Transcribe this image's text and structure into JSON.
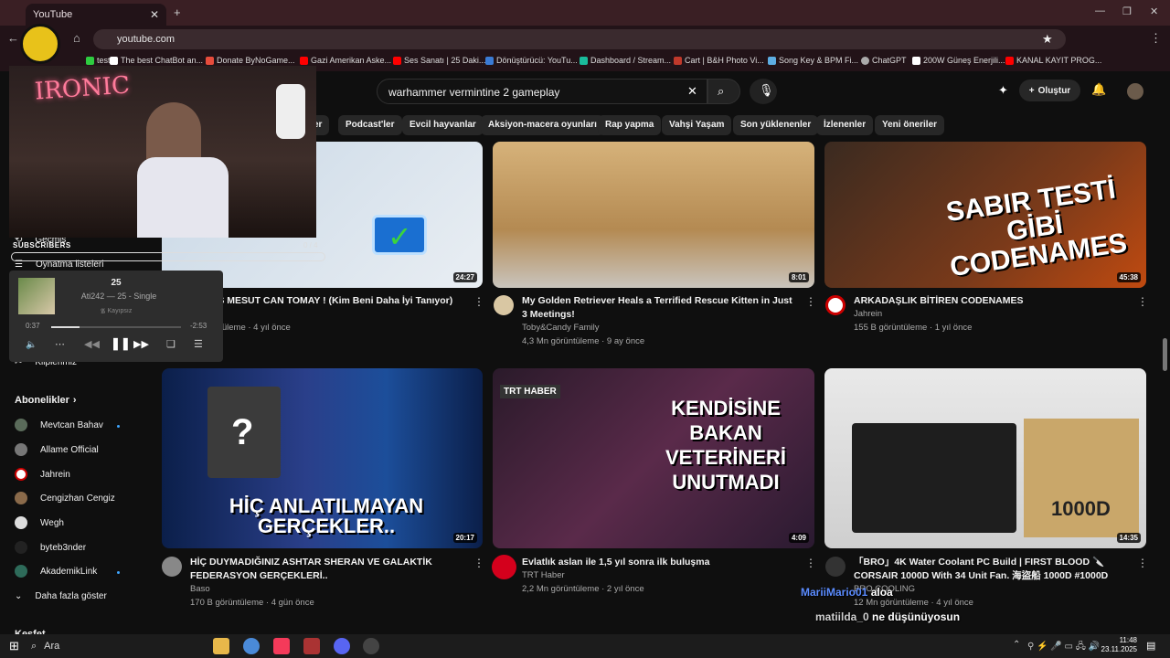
{
  "browser": {
    "tab_title": "YouTube",
    "url": "youtube.com",
    "bookmarks": [
      "test",
      "The best ChatBot an...",
      "Donate ByNoGame...",
      "Gazi Amerikan Aske...",
      "Ses Sanatı | 25 Daki...",
      "Dönüştürücü: YouTu...",
      "Dashboard / Stream...",
      "Cart | B&H Photo Vi...",
      "Song Key & BPM Fi...",
      "ChatGPT",
      "200W Güneş Enerjili...",
      "KANAL KAYIT PROG..."
    ]
  },
  "header": {
    "search_value": "warhammer vermintine 2 gameplay",
    "create_label": "Oluştur"
  },
  "chips": [
    "er",
    "Podcast'ler",
    "Evcil hayvanlar",
    "Aksiyon-macera oyunları",
    "Rap yapma",
    "Vahşi Yaşam",
    "Son yüklenenler",
    "İzlenenler",
    "Yeni öneriler"
  ],
  "sidebar": {
    "history": "Geçmiş",
    "playlists": "Oynatma listeleri",
    "clips": "Kliplerimiz",
    "subs_heading": "Abonelikler",
    "subscriptions": [
      "Mevtcan Bahav",
      "Allame Official",
      "Jahrein",
      "Cengizhan Cengiz",
      "Wegh",
      "byteb3nder",
      "AkademikLink"
    ],
    "more": "Daha fazla göster",
    "explore": "Keşfet"
  },
  "videos": [
    {
      "title": "...İM VS MESUT CAN TOMAY ! (Kim Beni Daha İyi Tanıyor)",
      "channel": "...m",
      "meta": "...görüntüleme · 4 yıl önce",
      "duration": "24:27"
    },
    {
      "title": "My Golden Retriever Heals a Terrified Rescue Kitten in Just 3 Meetings!",
      "channel": "Toby&Candy Family",
      "meta": "4,3 Mn görüntüleme · 9 ay önce",
      "duration": "8:01"
    },
    {
      "title": "ARKADAŞLIK BİTİREN CODENAMES",
      "channel": "Jahrein",
      "meta": "155 B görüntüleme · 1 yıl önce",
      "duration": "45:38",
      "thumb_text": "SABIR TESTİ GİBİ CODENAMES"
    },
    {
      "title": "HİÇ DUYMADIĞINIZ ASHTAR SHERAN VE GALAKTİK FEDERASYON GERÇEKLERİ..",
      "channel": "Baso",
      "meta": "170 B görüntüleme · 4 gün önce",
      "duration": "20:17",
      "thumb_text": "HİÇ ANLATILMAYAN GERÇEKLER.."
    },
    {
      "title": "Evlatlık aslan ile 1,5 yıl sonra ilk buluşma",
      "channel": "TRT Haber",
      "meta": "2,2 Mn görüntüleme · 2 yıl önce",
      "duration": "4:09",
      "thumb_text": "KENDİSİNE BAKAN VETERİNERİ UNUTMADI",
      "thumb_brand": "TRT HABER"
    },
    {
      "title": "「BRO」4K Water Coolant PC Build | FIRST BLOOD 🔪 CORSAIR 1000D With 34 Unit Fan. 海盜船 1000D #1000D",
      "channel": "BRO COOLING",
      "meta": "12 Mn görüntüleme · 4 yıl önce",
      "duration": "14:35",
      "thumb_text": "1000D"
    }
  ],
  "overlay": {
    "cam_sign": "IRONIC",
    "subscribers_label": "SUBSCRIBERS",
    "subscribers_count": "0 / 4",
    "player_track": "25",
    "player_artist": "Ati242 — 25 - Single",
    "player_lossless": "Kayıpsız",
    "player_elapsed": "0:37",
    "player_remaining": "-2:53",
    "player_progress": 0.22
  },
  "chat": [
    {
      "user": "MariiMario01",
      "msg": "aloa"
    },
    {
      "user": "matiilda_0",
      "msg": "ne düşünüyosun"
    }
  ],
  "taskbar": {
    "search": "Ara",
    "time": "11:48",
    "date": "23.11.2025"
  },
  "colors": {
    "accent": "#ff0000",
    "chat_user1": "#5b8cff",
    "chat_user2": "#cfcfcf"
  }
}
